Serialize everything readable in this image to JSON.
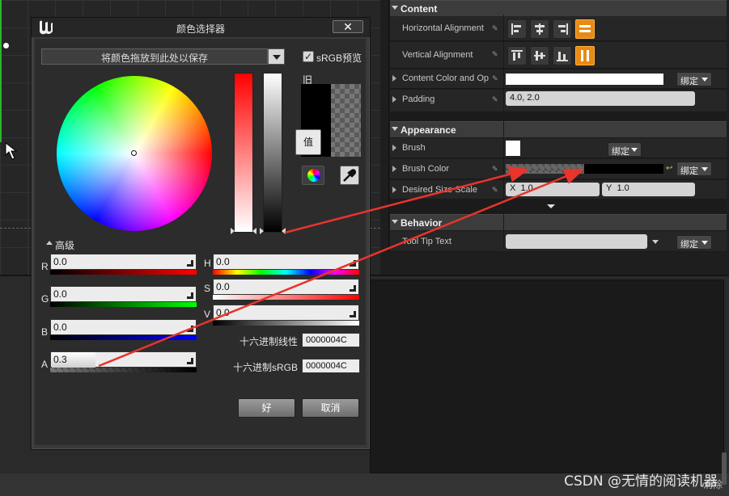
{
  "details": {
    "content_header": "Content",
    "rows": {
      "h_align": "Horizontal Alignment",
      "v_align": "Vertical Alignment",
      "content_color": "Content Color and Op",
      "padding": "Padding",
      "padding_value": "4.0, 2.0",
      "bind_label": "绑定"
    },
    "appearance_header": "Appearance",
    "appearance": {
      "brush": "Brush",
      "brush_color": "Brush Color",
      "desired_size": "Desired Size Scale",
      "x_label": "X",
      "x_value": "1.0",
      "y_label": "Y",
      "y_value": "1.0"
    },
    "behavior_header": "Behavior",
    "behavior": {
      "tooltip": "Tool Tip Text"
    }
  },
  "picker": {
    "title": "颜色选择器",
    "drag_hint": "将颜色拖放到此处以保存",
    "srgb_label": "sRGB预览",
    "old_label": "旧",
    "value_button": "值",
    "advanced_label": "高级",
    "channels": {
      "r": {
        "label": "R",
        "value": "0.0"
      },
      "g": {
        "label": "G",
        "value": "0.0"
      },
      "b": {
        "label": "B",
        "value": "0.0"
      },
      "a": {
        "label": "A",
        "value": "0.3"
      },
      "h": {
        "label": "H",
        "value": "0.0"
      },
      "s": {
        "label": "S",
        "value": "0.0"
      },
      "v": {
        "label": "V",
        "value": "0.0"
      }
    },
    "alpha_fraction": 0.3,
    "hex_linear_label": "十六进制线性",
    "hex_linear_value": "0000004C",
    "hex_srgb_label": "十六进制sRGB",
    "hex_srgb_value": "0000004C",
    "ok_label": "好",
    "cancel_label": "取消"
  },
  "bottom_label": "消除",
  "watermark": "CSDN @无情的阅读机器",
  "colors": {
    "accent": "#e88a14",
    "annotation_arrow": "#e8342c",
    "selection": "#2bb52b"
  }
}
